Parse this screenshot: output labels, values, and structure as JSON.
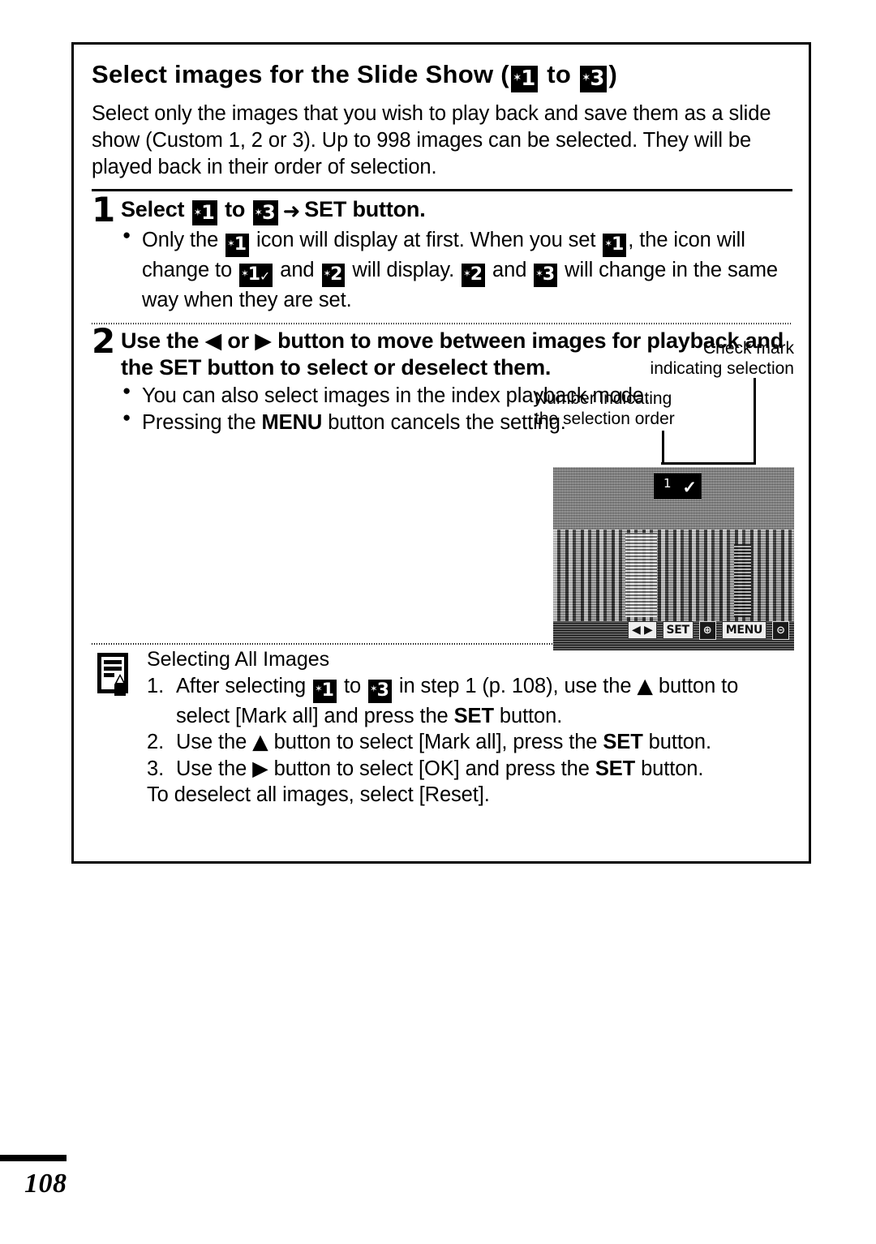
{
  "page": {
    "number": "108"
  },
  "section": {
    "title_prefix": "Select images for the Slide Show (",
    "title_to": " to ",
    "title_suffix": ")",
    "intro": "Select only the images that you wish to play back and save them as a slide show (Custom 1, 2 or 3). Up to 998 images can be selected. They will be played back in their order of selection."
  },
  "icons": {
    "star": "✶",
    "check": "✓",
    "custom1": "1",
    "custom2": "2",
    "custom3": "3",
    "arrow_right_fat": "➜",
    "triangle_left": "◀",
    "triangle_right": "▶",
    "triangle_up": "▲",
    "bullet": "●"
  },
  "step1": {
    "number": "1",
    "head_a": "Select ",
    "head_to": " to ",
    "head_b": " ",
    "head_set": "SET",
    "head_c": " button.",
    "bullet_a": "Only the ",
    "bullet_b": " icon will display at first. When you set ",
    "bullet_c": ", the icon will change to ",
    "bullet_d": " and ",
    "bullet_e": " will display. ",
    "bullet_f": " and ",
    "bullet_g": " will change in the same way when they are set."
  },
  "step2": {
    "number": "2",
    "head_a": "Use the ",
    "head_or": " or ",
    "head_b": " button to move between images for playback and the ",
    "head_set": "SET",
    "head_c": " button to select or deselect them.",
    "bullet1": "You can also select images in the index playback mode.",
    "bullet2_a": "Pressing the ",
    "bullet2_menu": "MENU",
    "bullet2_b": " button cancels the setting."
  },
  "callouts": {
    "check_mark": "Check mark\nindicating selection",
    "check_mark_line1": "Check mark",
    "check_mark_line2": "indicating selection",
    "number_order_line1": "Number indicating",
    "number_order_line2": "the selection order"
  },
  "lcd": {
    "badge_number": "1",
    "badge_check": "✓",
    "osd_left": "◀ ▶",
    "osd_set_label": "SET",
    "osd_set_key": "⊕",
    "osd_menu_label": "MENU",
    "osd_menu_key": "⊝"
  },
  "note": {
    "icon_name": "memo-pencil-icon",
    "title": "Selecting All Images",
    "items": [
      {
        "num": "1.",
        "a": "After selecting ",
        "b": " to ",
        "c": " in step 1 (p. 108), use the ",
        "d": " button to select [Mark all] and press the ",
        "set": "SET",
        "e": " button."
      },
      {
        "num": "2.",
        "a": "Use the ",
        "b": " button to select [Mark all], press the ",
        "set": "SET",
        "c": " button."
      },
      {
        "num": "3.",
        "a": "Use the ",
        "b": " button to select [OK] and press the ",
        "set": "SET",
        "c": " button."
      }
    ],
    "tail": "To deselect all images, select [Reset]."
  },
  "colors": {
    "ink": "#000000",
    "paper": "#ffffff"
  }
}
